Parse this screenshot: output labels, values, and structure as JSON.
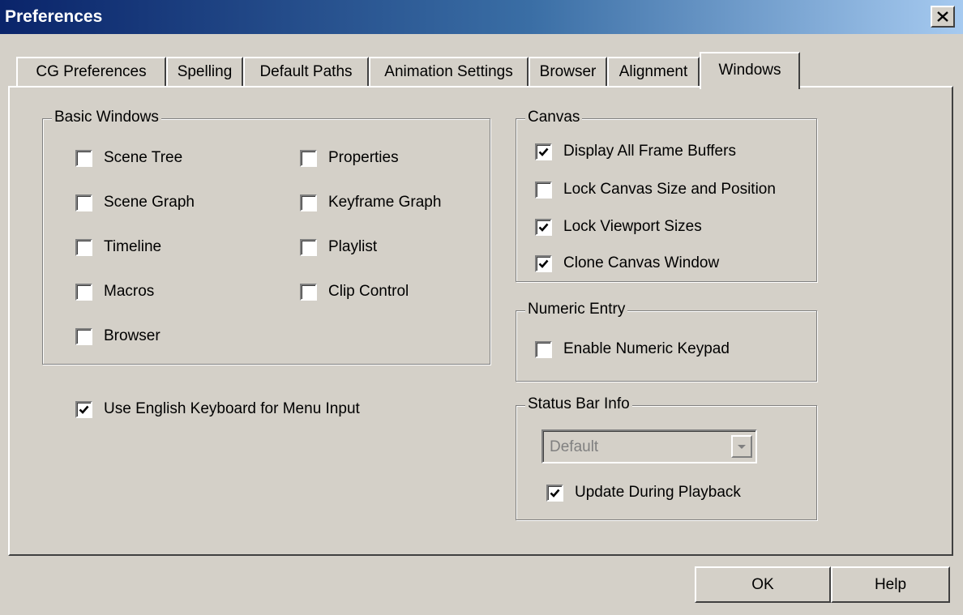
{
  "window": {
    "title": "Preferences",
    "close_label": "×"
  },
  "tabs": [
    {
      "label": "CG Preferences"
    },
    {
      "label": "Spelling"
    },
    {
      "label": "Default Paths"
    },
    {
      "label": "Animation Settings"
    },
    {
      "label": "Browser"
    },
    {
      "label": "Alignment"
    },
    {
      "label": "Windows",
      "active": true
    }
  ],
  "basic_windows": {
    "title": "Basic Windows",
    "items": [
      {
        "label": "Scene Tree",
        "checked": false
      },
      {
        "label": "Scene Graph",
        "checked": false
      },
      {
        "label": "Timeline",
        "checked": false
      },
      {
        "label": "Macros",
        "checked": false
      },
      {
        "label": "Browser",
        "checked": false
      },
      {
        "label": "Properties",
        "checked": false
      },
      {
        "label": "Keyframe Graph",
        "checked": false
      },
      {
        "label": "Playlist",
        "checked": false
      },
      {
        "label": "Clip Control",
        "checked": false
      }
    ]
  },
  "english_keyboard": {
    "label": "Use English Keyboard for Menu Input",
    "checked": true
  },
  "canvas": {
    "title": "Canvas",
    "items": [
      {
        "label": "Display All Frame Buffers",
        "checked": true
      },
      {
        "label": "Lock Canvas Size and Position",
        "checked": false
      },
      {
        "label": "Lock Viewport Sizes",
        "checked": true
      },
      {
        "label": "Clone Canvas Window",
        "checked": true
      }
    ]
  },
  "numeric_entry": {
    "title": "Numeric Entry",
    "items": [
      {
        "label": "Enable Numeric Keypad",
        "checked": false
      }
    ]
  },
  "status_bar": {
    "title": "Status Bar Info",
    "dropdown_value": "Default",
    "dropdown_disabled": true,
    "update_playback": {
      "label": "Update During Playback",
      "checked": true
    }
  },
  "buttons": {
    "ok": "OK",
    "help": "Help"
  },
  "icons": {
    "close": "close-icon",
    "dropdown_arrow": "chevron-down-icon",
    "check": "checkmark-icon"
  }
}
